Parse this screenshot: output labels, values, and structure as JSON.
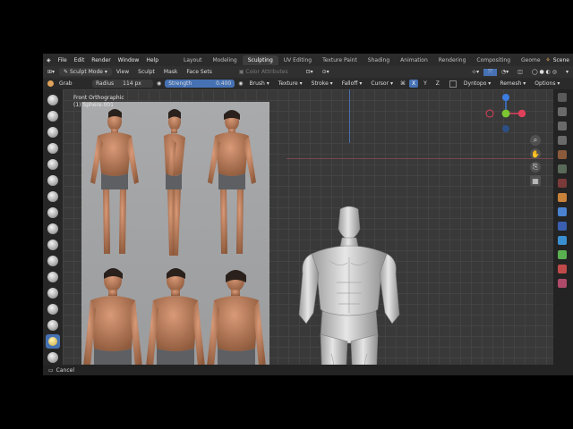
{
  "menubar": {
    "items": [
      "File",
      "Edit",
      "Render",
      "Window",
      "Help"
    ],
    "workspaces": [
      "Layout",
      "Modeling",
      "Sculpting",
      "UV Editing",
      "Texture Paint",
      "Shading",
      "Animation",
      "Rendering",
      "Compositing",
      "Geome"
    ],
    "active_workspace": "Sculpting",
    "scene": "Scene"
  },
  "header": {
    "mode": "Sculpt Mode",
    "items": [
      "View",
      "Sculpt",
      "Mask",
      "Face Sets"
    ],
    "color_attributes": "Color Attributes"
  },
  "toolsettings": {
    "brush": "Grab",
    "radius_label": "Radius",
    "radius_value": "114 px",
    "strength_label": "Strength",
    "strength_value": "0.400",
    "dropdowns": [
      "Brush",
      "Texture",
      "Stroke",
      "Falloff",
      "Cursor"
    ],
    "axes": [
      "X",
      "Y",
      "Z"
    ],
    "dyntopo": "Dyntopo",
    "remesh": "Remesh",
    "options": "Options"
  },
  "viewport": {
    "view_name": "Front Orthographic",
    "object_name": "(1) Sphere.001"
  },
  "status": {
    "cancel": "Cancel"
  },
  "colors": {
    "accent": "#4672b4",
    "x_axis": "#e0405a",
    "y_axis": "#7bc631",
    "z_axis": "#3b7de0"
  }
}
